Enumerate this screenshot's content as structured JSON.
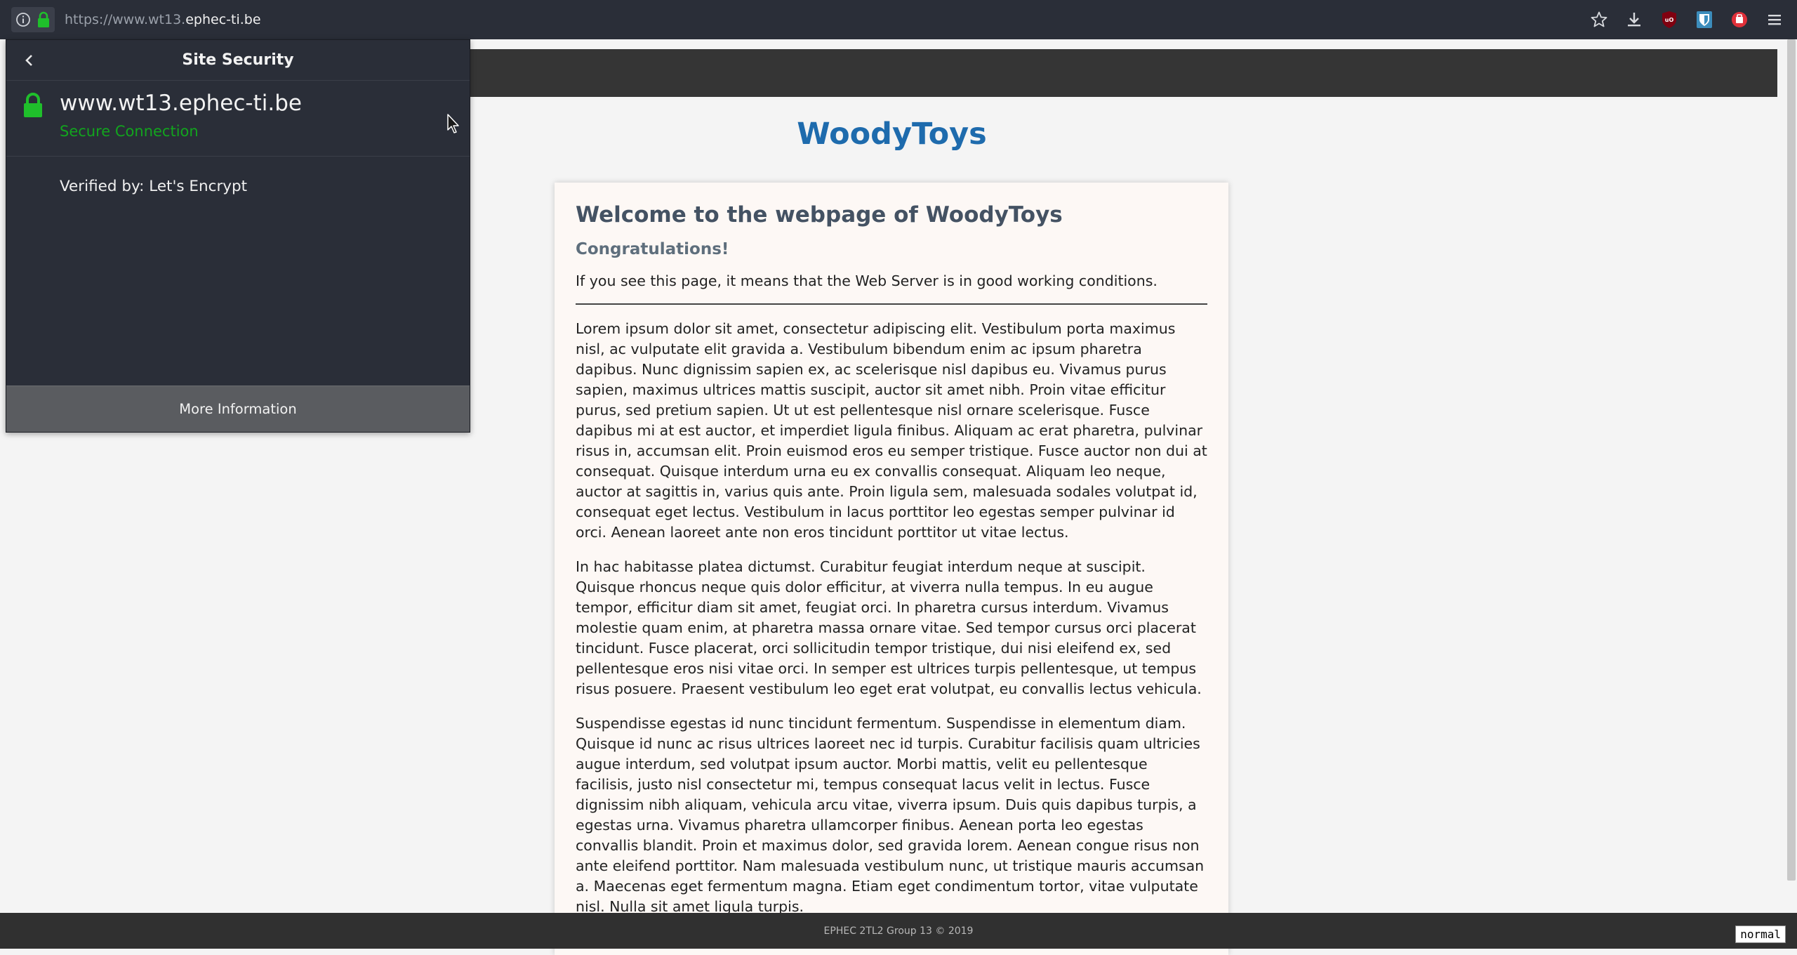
{
  "browser": {
    "url_prefix": "https://www.wt13.",
    "url_domain": "ephec-ti.be",
    "icons": [
      "info-icon",
      "lock-icon",
      "bookmark-star-icon",
      "download-icon",
      "ublock-icon",
      "bitwarden-icon",
      "addon-icon",
      "menu-icon"
    ]
  },
  "security_panel": {
    "title": "Site Security",
    "host": "www.wt13.ephec-ti.be",
    "status": "Secure Connection",
    "verified_by": "Verified by: Let's Encrypt",
    "more_info": "More Information",
    "status_color": "#12a41e"
  },
  "site": {
    "title": "WoodyToys",
    "heading": "Welcome to the webpage of WoodyToys",
    "subheading": "Congratulations!",
    "lead": "If you see this page, it means that the Web Server is in good working conditions.",
    "paragraphs": [
      "Lorem ipsum dolor sit amet, consectetur adipiscing elit. Vestibulum porta maximus nisl, ac vulputate elit gravida a. Vestibulum bibendum enim ac ipsum pharetra dapibus. Nunc dignissim sapien ex, ac scelerisque nisl dapibus eu. Vivamus purus sapien, maximus ultrices mattis suscipit, auctor sit amet nibh. Proin vitae efficitur purus, sed pretium sapien. Ut ut est pellentesque nisl ornare scelerisque. Fusce dapibus mi at est auctor, et imperdiet ligula finibus. Aliquam ac erat pharetra, pulvinar risus in, accumsan elit. Proin euismod eros eu semper tristique. Fusce auctor non dui at consequat. Quisque interdum urna eu ex convallis consequat. Aliquam leo neque, auctor at sagittis in, varius quis ante. Proin ligula sem, malesuada sodales volutpat id, consequat eget lectus. Vestibulum in lacus porttitor leo egestas semper pulvinar id orci. Aenean laoreet ante non eros tincidunt porttitor ut vitae lectus.",
      "In hac habitasse platea dictumst. Curabitur feugiat interdum neque at suscipit. Quisque rhoncus neque quis dolor efficitur, at viverra nulla tempus. In eu augue tempor, efficitur diam sit amet, feugiat orci. In pharetra cursus interdum. Vivamus molestie quam enim, at pharetra massa ornare vitae. Sed tempor cursus orci placerat tincidunt. Fusce placerat, orci sollicitudin tempor tristique, dui nisi eleifend ex, sed pellentesque eros nisi vitae orci. In semper est ultrices turpis pellentesque, ut tempus risus posuere. Praesent vestibulum leo eget erat volutpat, eu convallis lectus vehicula.",
      "Suspendisse egestas id nunc tincidunt fermentum. Suspendisse in elementum diam. Quisque id nunc ac risus ultrices laoreet nec id turpis. Curabitur facilisis quam ultricies augue interdum, sed volutpat ipsum auctor. Morbi mattis, velit eu pellentesque facilisis, justo nisl consectetur mi, tempus consequat lacus velit in lectus. Fusce dignissim nibh aliquam, vehicula arcu vitae, viverra ipsum. Duis quis dapibus turpis, a egestas urna. Vivamus pharetra ullamcorper finibus. Aenean porta leo egestas convallis blandit. Proin et maximus dolor, sed gravida lorem. Aenean congue risus non ante eleifend porttitor. Nam malesuada vestibulum nunc, ut tristique mauris accumsan a. Maecenas eget fermentum magna. Etiam eget condimentum tortor, vitae vulputate nisl. Nulla sit amet ligula turpis."
    ],
    "footer": "EPHEC 2TL2 Group 13 © 2019",
    "title_color": "#1e6bad"
  },
  "mode_indicator": "normal"
}
